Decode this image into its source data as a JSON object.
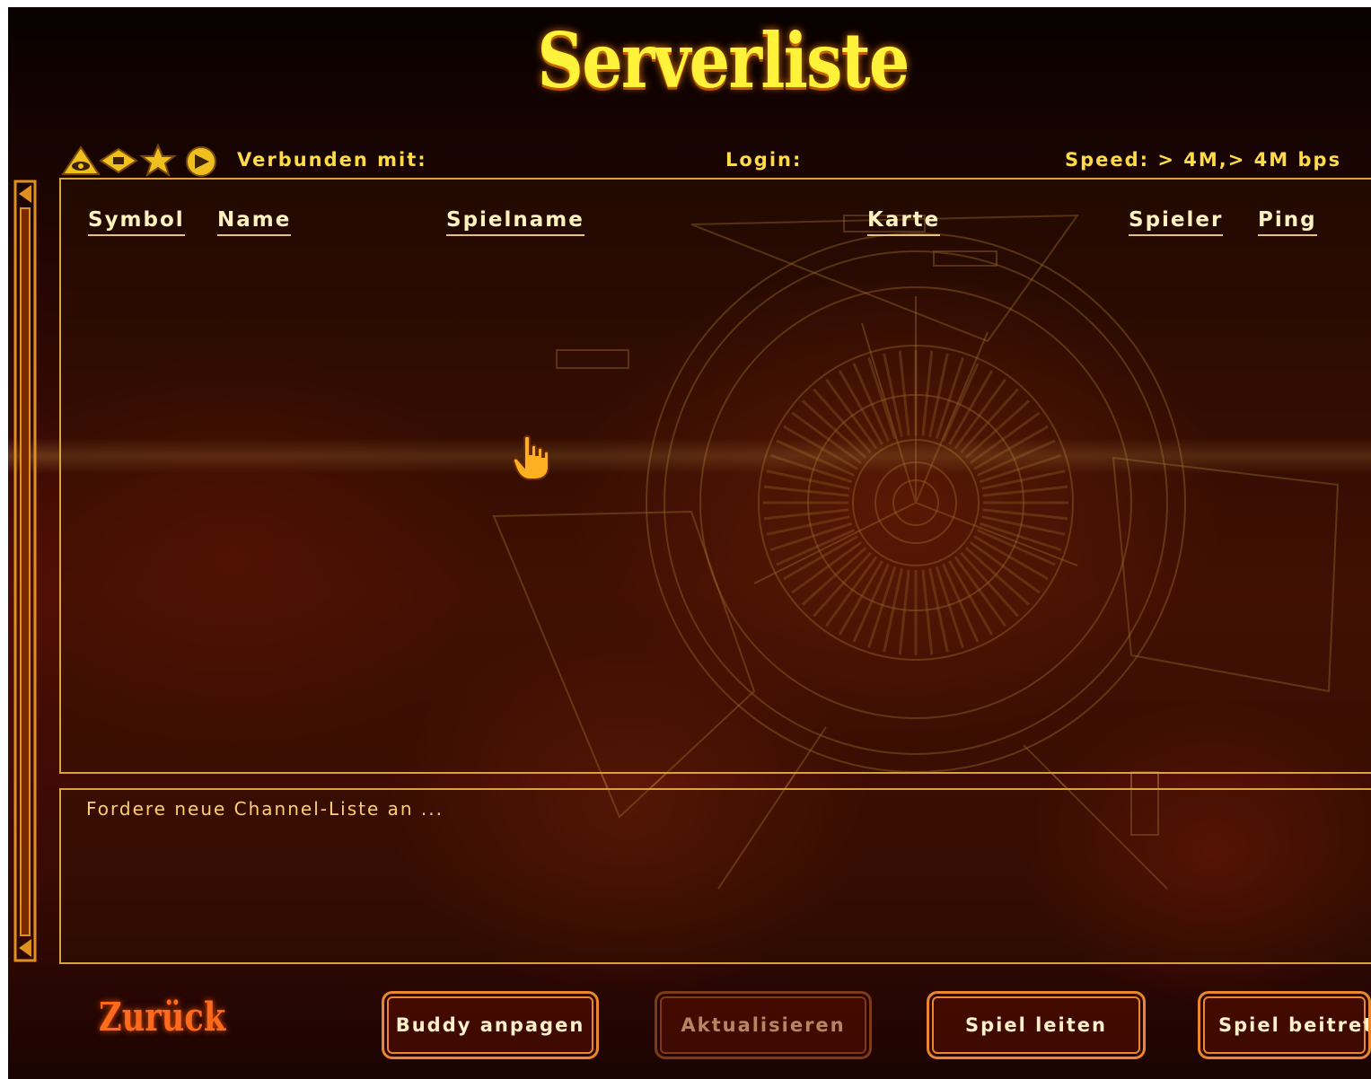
{
  "title": "Serverliste",
  "status_bar": {
    "connected_label": "Verbunden mit:",
    "login_label": "Login:",
    "speed_label": "Speed: > 4M,> 4M bps",
    "filter_icons": [
      "eye-triangle-icon",
      "diamond-icon",
      "star-icon",
      "arrow-circle-icon"
    ]
  },
  "columns": {
    "symbol": "Symbol",
    "name": "Name",
    "spielname": "Spielname",
    "karte": "Karte",
    "spieler": "Spieler",
    "ping": "Ping"
  },
  "servers": [],
  "log": {
    "lines": [
      "Fordere neue Channel-Liste an ..."
    ]
  },
  "buttons": {
    "back": "Zurück",
    "buddy": "Buddy anpagen",
    "refresh": "Aktualisieren",
    "host": "Spiel leiten",
    "join": "Spiel beitreten"
  },
  "colors": {
    "title": "#fff23a",
    "header_text": "#ffdb4a",
    "panel_border": "#d9a23a",
    "button_border": "#e9862e",
    "back_text": "#ff6a1c"
  }
}
